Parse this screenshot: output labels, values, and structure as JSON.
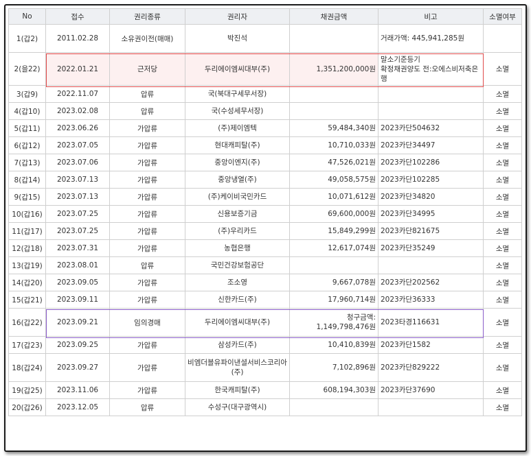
{
  "columns": [
    "No",
    "접수",
    "권리종류",
    "권리자",
    "채권금액",
    "비고",
    "소멸여부"
  ],
  "rows": [
    {
      "no": "1(갑2)",
      "date": "2011.02.28",
      "type": "소유권이전(매매)",
      "holder": "박진석",
      "amount": "",
      "note": "거래가액: 445,941,285원",
      "status": ""
    },
    {
      "no": "2(을22)",
      "date": "2022.01.21",
      "type": "근저당",
      "holder": "두리에이엠씨대부(주)",
      "amount": "1,351,200,000원",
      "note": "말소기준등기\n확정채권양도 전:오에스비저축은행",
      "status": "소멸"
    },
    {
      "no": "3(갑9)",
      "date": "2022.11.07",
      "type": "압류",
      "holder": "국(북대구세무서장)",
      "amount": "",
      "note": "",
      "status": "소멸"
    },
    {
      "no": "4(갑10)",
      "date": "2023.02.08",
      "type": "압류",
      "holder": "국(수성세무서장)",
      "amount": "",
      "note": "",
      "status": "소멸"
    },
    {
      "no": "5(갑11)",
      "date": "2023.06.26",
      "type": "가압류",
      "holder": "(주)제이엠텍",
      "amount": "59,484,340원",
      "note": "2023카단504632",
      "status": "소멸"
    },
    {
      "no": "6(갑12)",
      "date": "2023.07.05",
      "type": "가압류",
      "holder": "현대캐피탈(주)",
      "amount": "10,710,033원",
      "note": "2023카단34497",
      "status": "소멸"
    },
    {
      "no": "7(갑13)",
      "date": "2023.07.06",
      "type": "가압류",
      "holder": "중앙이엔지(주)",
      "amount": "47,526,021원",
      "note": "2023카단102286",
      "status": "소멸"
    },
    {
      "no": "8(갑14)",
      "date": "2023.07.13",
      "type": "가압류",
      "holder": "중앙냉열(주)",
      "amount": "49,058,575원",
      "note": "2023카단102285",
      "status": "소멸"
    },
    {
      "no": "9(갑15)",
      "date": "2023.07.13",
      "type": "가압류",
      "holder": "(주)케이비국민카드",
      "amount": "10,071,612원",
      "note": "2023카단34820",
      "status": "소멸"
    },
    {
      "no": "10(갑16)",
      "date": "2023.07.25",
      "type": "가압류",
      "holder": "신용보증기금",
      "amount": "69,600,000원",
      "note": "2023카단34995",
      "status": "소멸"
    },
    {
      "no": "11(갑17)",
      "date": "2023.07.25",
      "type": "가압류",
      "holder": "(주)우리카드",
      "amount": "15,849,299원",
      "note": "2023카단821675",
      "status": "소멸"
    },
    {
      "no": "12(갑18)",
      "date": "2023.07.31",
      "type": "가압류",
      "holder": "농협은행",
      "amount": "12,617,074원",
      "note": "2023카단35249",
      "status": "소멸"
    },
    {
      "no": "13(갑19)",
      "date": "2023.08.01",
      "type": "압류",
      "holder": "국민건강보험공단",
      "amount": "",
      "note": "",
      "status": "소멸"
    },
    {
      "no": "14(갑20)",
      "date": "2023.09.05",
      "type": "가압류",
      "holder": "조소영",
      "amount": "9,667,078원",
      "note": "2023카단202562",
      "status": "소멸"
    },
    {
      "no": "15(갑21)",
      "date": "2023.09.11",
      "type": "가압류",
      "holder": "신한카드(주)",
      "amount": "17,960,714원",
      "note": "2023카단36333",
      "status": "소멸"
    },
    {
      "no": "16(갑22)",
      "date": "2023.09.21",
      "type": "임의경매",
      "holder": "두리에이엠씨대부(주)",
      "amount": "청구금액:\n1,149,798,476원",
      "note": "2023타경116631",
      "status": "소멸"
    },
    {
      "no": "17(갑23)",
      "date": "2023.09.25",
      "type": "가압류",
      "holder": "삼성카드(주)",
      "amount": "10,410,839원",
      "note": "2023카단1582",
      "status": "소멸"
    },
    {
      "no": "18(갑24)",
      "date": "2023.09.27",
      "type": "가압류",
      "holder": "비엠더블유파이낸셜서비스코리아(주)",
      "amount": "7,102,896원",
      "note": "2023카단829222",
      "status": "소멸"
    },
    {
      "no": "19(갑25)",
      "date": "2023.11.06",
      "type": "가압류",
      "holder": "한국캐피탈(주)",
      "amount": "608,194,303원",
      "note": "2023카단37690",
      "status": "소멸"
    },
    {
      "no": "20(갑26)",
      "date": "2023.12.05",
      "type": "압류",
      "holder": "수성구(대구광역시)",
      "amount": "",
      "note": "",
      "status": "소멸"
    }
  ],
  "highlights": {
    "red_box_color": "#e04a4a",
    "purple_box_color": "#8a5cc9",
    "pink_fill": "#fdf0f0"
  }
}
